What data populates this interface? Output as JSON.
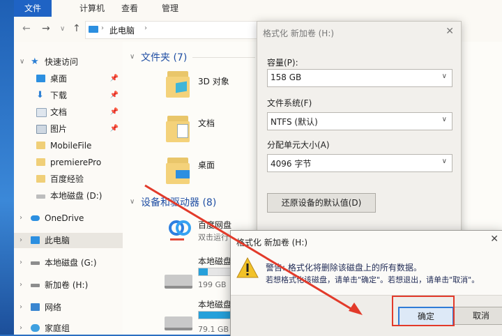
{
  "ribbon": {
    "tabs": [
      "文件",
      "计算机",
      "查看",
      "管理"
    ]
  },
  "address": {
    "path": "此电脑"
  },
  "nav": {
    "quick_access": "快速访问",
    "items": [
      {
        "label": "桌面",
        "pinned": true
      },
      {
        "label": "下载",
        "pinned": true
      },
      {
        "label": "文档",
        "pinned": true
      },
      {
        "label": "图片",
        "pinned": true
      },
      {
        "label": "MobileFile",
        "pinned": false
      },
      {
        "label": "premierePro",
        "pinned": false
      },
      {
        "label": "百度经验",
        "pinned": false
      },
      {
        "label": "本地磁盘 (D:)",
        "pinned": false
      }
    ],
    "onedrive": "OneDrive",
    "this_pc": "此电脑",
    "drives": [
      "本地磁盘 (G:)",
      "新加卷 (H:)"
    ],
    "network": "网络",
    "homegroup": "家庭组"
  },
  "content": {
    "folders_group": "文件夹 (7)",
    "folders": [
      "3D 对象",
      "文档",
      "桌面"
    ],
    "devices_group": "设备和驱动器 (8)",
    "devices": [
      {
        "name": "百度网盘",
        "sub": "双击运行"
      },
      {
        "name": "本地磁盘",
        "size": "199 GB",
        "fill": 0.08
      },
      {
        "name": "本地磁盘",
        "size": "79.1 GB 可用,",
        "fill": 0.35
      }
    ]
  },
  "format_dialog": {
    "title": "格式化 新加卷 (H:)",
    "capacity_label": "容量(P):",
    "capacity_value": "158 GB",
    "fs_label": "文件系统(F)",
    "fs_value": "NTFS (默认)",
    "alloc_label": "分配单元大小(A)",
    "alloc_value": "4096 字节",
    "restore_button": "还原设备的默认值(D)"
  },
  "warning_dialog": {
    "title": "格式化 新加卷 (H:)",
    "line1": "警告: 格式化将删除该磁盘上的所有数据。",
    "line2": "若想格式化该磁盘，请单击\"确定\"。若想退出，请单击\"取消\"。",
    "ok": "确定",
    "cancel": "取消"
  },
  "colors": {
    "accent": "#1f63c4",
    "annotation": "#e23a2a",
    "folder": "#f4d27a"
  }
}
